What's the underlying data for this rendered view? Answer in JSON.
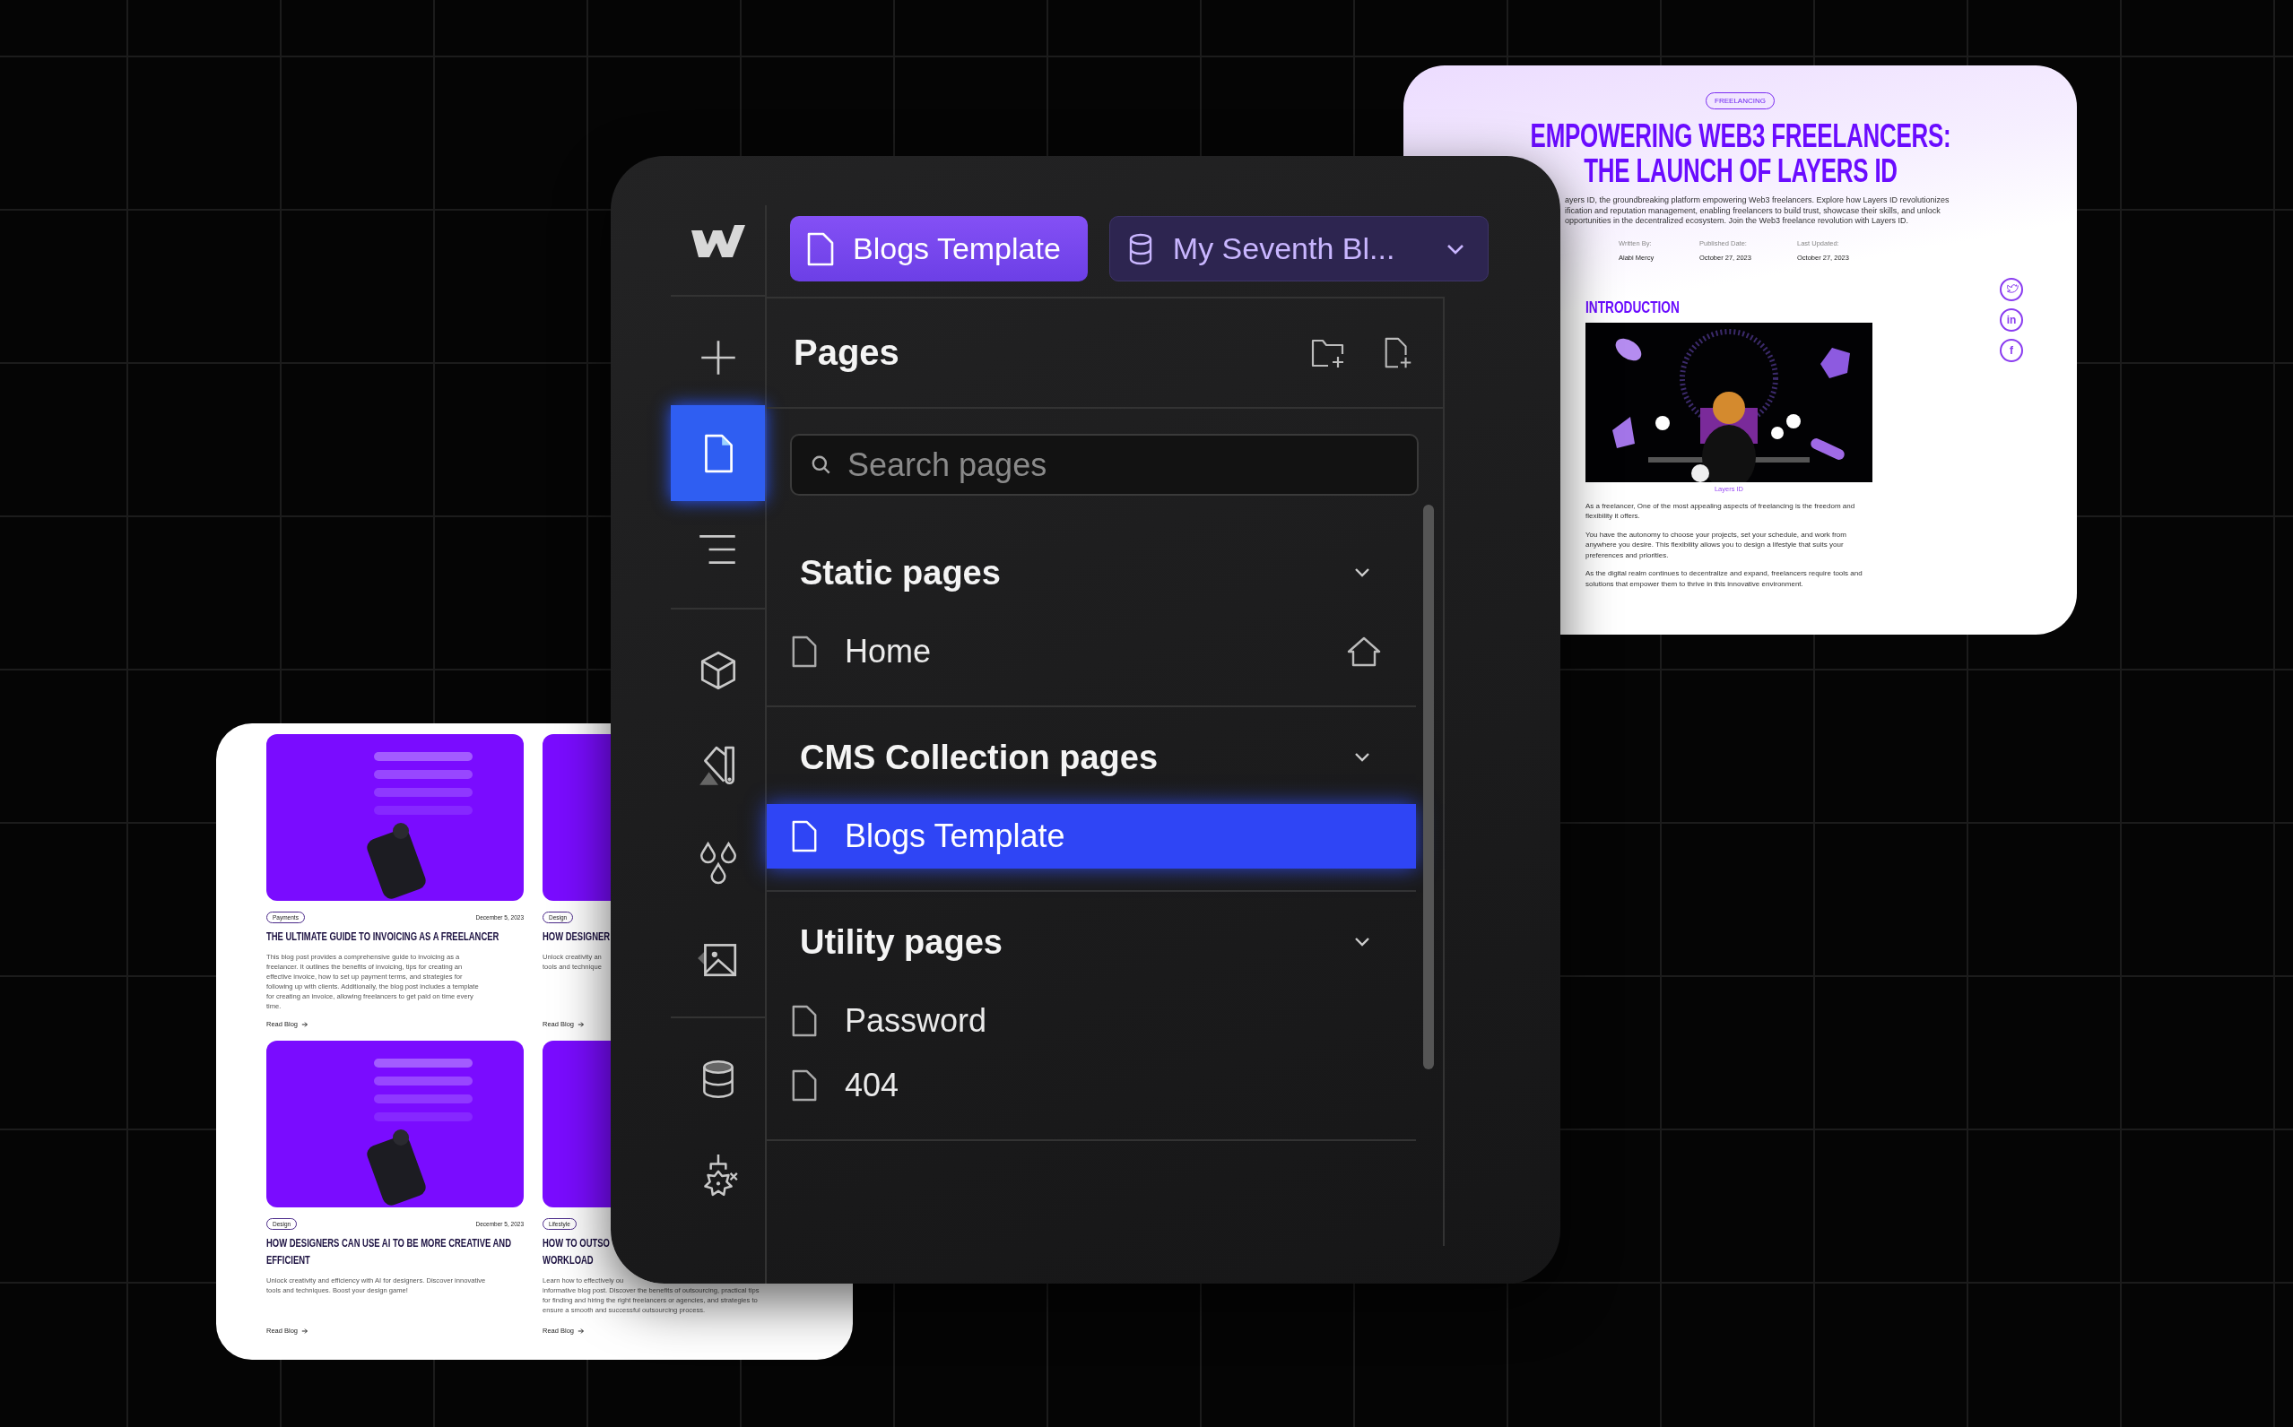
{
  "editor": {
    "page_button": {
      "label": "Blogs Template"
    },
    "collection_dropdown": {
      "label": "My Seventh Bl..."
    },
    "rail_groups": [
      {
        "items": [
          {
            "kind": "add",
            "selected": false
          },
          {
            "kind": "pages",
            "selected": true
          },
          {
            "kind": "navigator",
            "selected": false
          }
        ]
      },
      {
        "items": [
          {
            "kind": "components",
            "selected": false
          },
          {
            "kind": "styles",
            "selected": false
          },
          {
            "kind": "variables",
            "selected": false
          },
          {
            "kind": "assets",
            "selected": false
          }
        ]
      },
      {
        "items": [
          {
            "kind": "cms",
            "selected": false
          },
          {
            "kind": "apps",
            "selected": false
          }
        ]
      }
    ],
    "pages_panel": {
      "title": "Pages",
      "search": {
        "placeholder": "Search pages"
      },
      "sections": [
        {
          "title": "Static pages",
          "expanded": true,
          "pages": [
            {
              "name": "Home",
              "home": true,
              "selected": false
            }
          ]
        },
        {
          "title": "CMS Collection pages",
          "expanded": true,
          "pages": [
            {
              "name": "Blogs Template",
              "home": false,
              "selected": true
            }
          ]
        },
        {
          "title": "Utility pages",
          "expanded": true,
          "pages": [
            {
              "name": "Password",
              "home": false,
              "selected": false
            },
            {
              "name": "404",
              "home": false,
              "selected": false
            }
          ]
        }
      ]
    }
  },
  "article_preview": {
    "tag": "FREELANCING",
    "title": "EMPOWERING WEB3 FREELANCERS: THE LAUNCH OF LAYERS ID",
    "intro_lines": [
      "ayers ID, the groundbreaking platform empowering Web3 freelancers. Explore how Layers ID revolutionizes",
      "ification and reputation management, enabling freelancers to build trust, showcase their skills, and unlock",
      "opportunities in the decentralized ecosystem. Join the Web3 freelance revolution with Layers ID."
    ],
    "meta": [
      {
        "label": "Written By:",
        "value": "Alabi Mercy"
      },
      {
        "label": "Published Date:",
        "value": "October 27, 2023"
      },
      {
        "label": "Last Updated:",
        "value": "October 27, 2023"
      }
    ],
    "section_heading": "INTRODUCTION",
    "image_caption": "Layers ID",
    "paragraphs": [
      "As a freelancer, One of the most appealing aspects of freelancing is the freedom and flexibility it offers.",
      "You have the autonomy to choose your projects, set your schedule, and work from anywhere you desire. This flexibility allows you to design a lifestyle that suits your preferences and priorities.",
      "As the digital realm continues to decentralize and expand, freelancers require tools and solutions that empower them to thrive in this innovative environment."
    ],
    "social_links": [
      {
        "kind": "bird"
      },
      {
        "kind": "glyph",
        "glyph": "in"
      },
      {
        "kind": "glyph",
        "glyph": "f"
      }
    ]
  },
  "blog_preview": {
    "posts": [
      {
        "tag": "Payments",
        "date": "December 5, 2023",
        "title_lines": [
          "THE ULTIMATE GUIDE TO INVOICING AS A FREELANCER"
        ],
        "excerpt_lines": [
          "This blog post provides a comprehensive guide to invoicing as a",
          "freelancer. It outlines the benefits of invoicing, tips for creating an",
          "effective invoice, how to set up payment terms, and strategies for",
          "following up with clients. Additionally, the blog post includes a template",
          "for creating an invoice, allowing freelancers to get paid on time every",
          "time."
        ],
        "link": "Read Blog"
      },
      {
        "tag": "Design",
        "title_lines": [
          "HOW DESIGNER"
        ],
        "excerpt_lines": [
          "Unlock creativity an",
          "tools and technique"
        ],
        "link": "Read Blog"
      },
      {
        "tag": "Design",
        "date": "December 5, 2023",
        "title_lines": [
          "HOW DESIGNERS CAN USE AI TO BE MORE CREATIVE AND",
          "EFFICIENT"
        ],
        "excerpt_lines": [
          "Unlock creativity and efficiency with AI for designers. Discover innovative",
          "tools and techniques. Boost your design game!"
        ],
        "link": "Read Blog"
      },
      {
        "tag": "Lifestyle",
        "title_lines": [
          "HOW TO OUTSO",
          "WORKLOAD"
        ],
        "excerpt_lines": [
          "Learn how to effectively ou",
          "informative blog post. Discover the benefits of outsourcing, practical tips",
          "for finding and hiring the right freelancers or agencies, and strategies to",
          "ensure a smooth and successful outsourcing process."
        ],
        "link": "Read Blog"
      }
    ]
  }
}
